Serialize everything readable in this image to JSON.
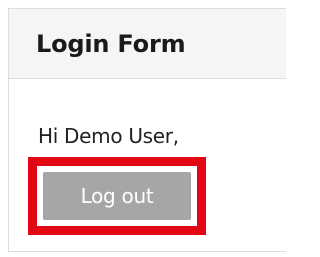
{
  "panel": {
    "title": "Login Form"
  },
  "greeting": "Hi Demo User,",
  "logout_button": {
    "label": "Log out"
  },
  "colors": {
    "highlight_border": "#e30613",
    "button_background": "#a6a6a6",
    "header_background": "#f5f5f5"
  }
}
